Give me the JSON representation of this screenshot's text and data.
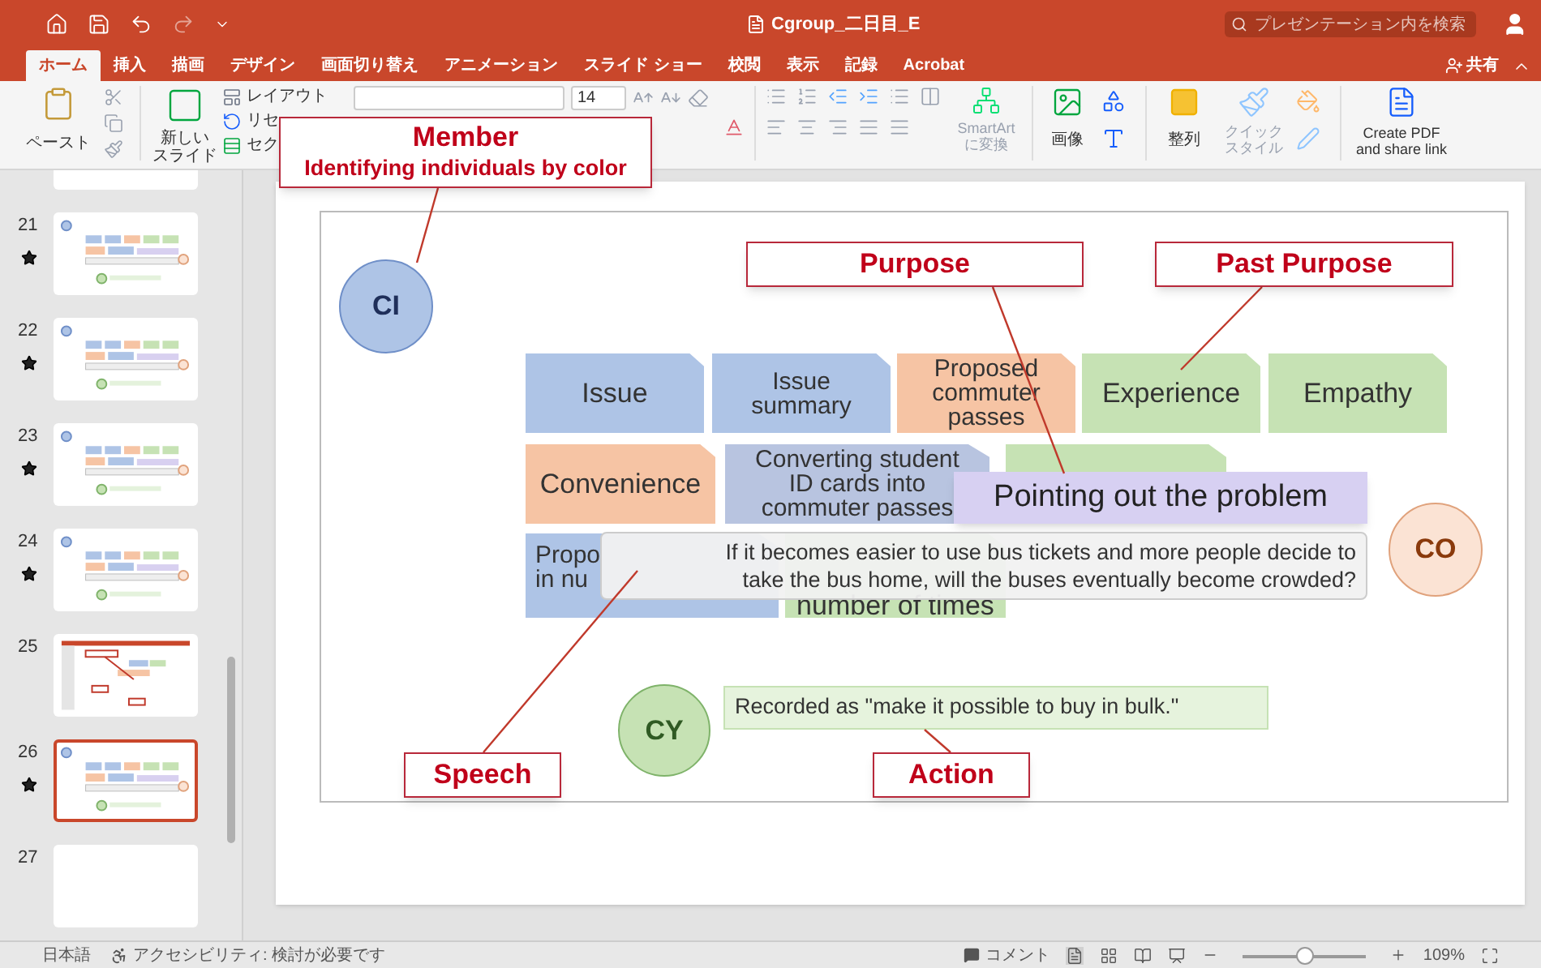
{
  "window": {
    "title": "Cgroup_二日目_E",
    "search": {
      "placeholder": "プレゼンテーション内を検索"
    },
    "share": "共有"
  },
  "tabs": [
    {
      "label": "ホーム",
      "selected": true
    },
    {
      "label": "挿入",
      "selected": false
    },
    {
      "label": "描画",
      "selected": false
    },
    {
      "label": "デザイン",
      "selected": false
    },
    {
      "label": "画面切り替え",
      "selected": false
    },
    {
      "label": "アニメーション",
      "selected": false
    },
    {
      "label": "スライド ショー",
      "selected": false
    },
    {
      "label": "校閲",
      "selected": false
    },
    {
      "label": "表示",
      "selected": false
    },
    {
      "label": "記録",
      "selected": false
    },
    {
      "label": "Acrobat",
      "selected": false
    }
  ],
  "ribbon": {
    "paste": "ペースト",
    "new_slide": [
      "新しい",
      "スライド"
    ],
    "menu_items": [
      {
        "kind": "layout",
        "label": "レイアウト"
      },
      {
        "kind": "reset",
        "label": "リセ"
      },
      {
        "kind": "section",
        "label": "セク"
      }
    ],
    "font_size": "14",
    "smartart": [
      "SmartArt",
      "に変換"
    ],
    "picture": "画像",
    "arrange": "整列",
    "quick_style": [
      "クイック",
      "スタイル"
    ],
    "pdf": [
      "Create PDF",
      "and share link"
    ]
  },
  "slide_panel": {
    "slides": [
      {
        "number": "21",
        "starred": true,
        "selected": false,
        "kind": "diagram"
      },
      {
        "number": "22",
        "starred": true,
        "selected": false,
        "kind": "diagram"
      },
      {
        "number": "23",
        "starred": true,
        "selected": false,
        "kind": "diagram"
      },
      {
        "number": "24",
        "starred": true,
        "selected": false,
        "kind": "diagram"
      },
      {
        "number": "25",
        "starred": false,
        "selected": false,
        "kind": "screenshot"
      },
      {
        "number": "26",
        "starred": true,
        "selected": true,
        "kind": "diagram"
      },
      {
        "number": "27",
        "starred": false,
        "selected": false,
        "kind": "blank"
      }
    ]
  },
  "slide": {
    "cards": [
      {
        "lines": [
          "Issue"
        ],
        "color": "#aec4e6"
      },
      {
        "lines": [
          "Issue",
          "summary"
        ],
        "color": "#aec4e6"
      },
      {
        "lines": [
          "Proposed",
          "commuter",
          "passes"
        ],
        "color": "#f6c4a4"
      },
      {
        "lines": [
          "Experience"
        ],
        "color": "#c6e2b4"
      },
      {
        "lines": [
          "Empathy"
        ],
        "color": "#c6e2b4"
      },
      {
        "lines": [
          "Convenience"
        ],
        "color": "#f6c4a4"
      },
      {
        "lines": [
          "Converting student",
          "ID cards into",
          "commuter passes"
        ],
        "color": "#b8c4e0"
      },
      {
        "color": "#c6e2b4"
      },
      {
        "lines": [
          "Propo",
          "in nu"
        ],
        "color": "#aec4e6"
      },
      {
        "lines": [
          "number of times"
        ],
        "color": "#c6e2b4"
      }
    ],
    "members": [
      {
        "initials": "CI",
        "color": "#aec4e6"
      },
      {
        "initials": "CO",
        "color": "#fbe3d4"
      },
      {
        "initials": "CY",
        "color": "#c6e2b4"
      }
    ],
    "tag": "Pointing out the problem",
    "speech": [
      "If it becomes easier to use bus tickets and more people decide to",
      "take the bus home, will the buses eventually become crowded?"
    ],
    "action": "Recorded as \"make it possible to buy in bulk.\""
  },
  "annotations": [
    {
      "title": "Member",
      "subtitle": "Identifying individuals by color"
    },
    {
      "title": "Purpose"
    },
    {
      "title": "Past Purpose"
    },
    {
      "title": "Speech"
    },
    {
      "title": "Action"
    }
  ],
  "status_bar": {
    "language": "日本語",
    "accessibility": "アクセシビリティ: 検討が必要です",
    "comments": "コメント",
    "zoom": {
      "level": 0.5,
      "reading": "109%"
    }
  }
}
